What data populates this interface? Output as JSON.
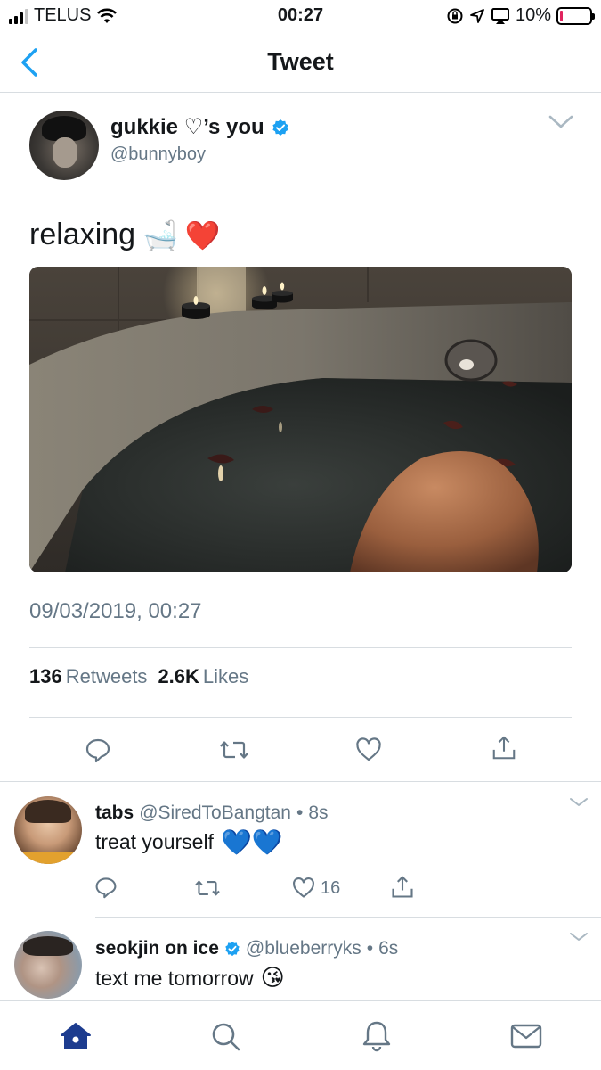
{
  "status_bar": {
    "carrier": "TELUS",
    "time": "00:27",
    "battery": "10%",
    "battery_level": 0.1
  },
  "nav": {
    "title": "Tweet"
  },
  "tweet": {
    "display_name": "gukkie ♡’s you",
    "handle": "@bunnyboy",
    "text": "relaxing",
    "emojis": [
      "🛁",
      "❤️"
    ],
    "timestamp": "09/03/2019, 00:27",
    "retweets_count": "136",
    "retweets_label": "Retweets",
    "likes_count": "2.6K",
    "likes_label": "Likes"
  },
  "replies": [
    {
      "name": "tabs",
      "handle": "@SiredToBangtan",
      "separator": "•",
      "time": "8s",
      "text": "treat yourself",
      "emojis": [
        "💙",
        "💙"
      ],
      "likes": "16",
      "verified": false
    },
    {
      "name": "seokjin on ice",
      "handle": "@blueberryks",
      "separator": "•",
      "time": "6s",
      "text": "text me tomorrow",
      "emojis": [
        "😘"
      ],
      "verified": true
    }
  ],
  "colors": {
    "accent": "#1da1f2",
    "secondary_text": "#657786",
    "divider": "#d8dde1",
    "tab_active": "#1d3c8f",
    "heart": "#e0245e",
    "blue_heart": "#1b6ff5"
  },
  "icons": [
    "back-chevron-icon",
    "verified-badge-icon",
    "caret-down-icon",
    "reply-icon",
    "retweet-icon",
    "like-icon",
    "share-icon",
    "home-icon",
    "search-icon",
    "notifications-icon",
    "messages-icon"
  ]
}
